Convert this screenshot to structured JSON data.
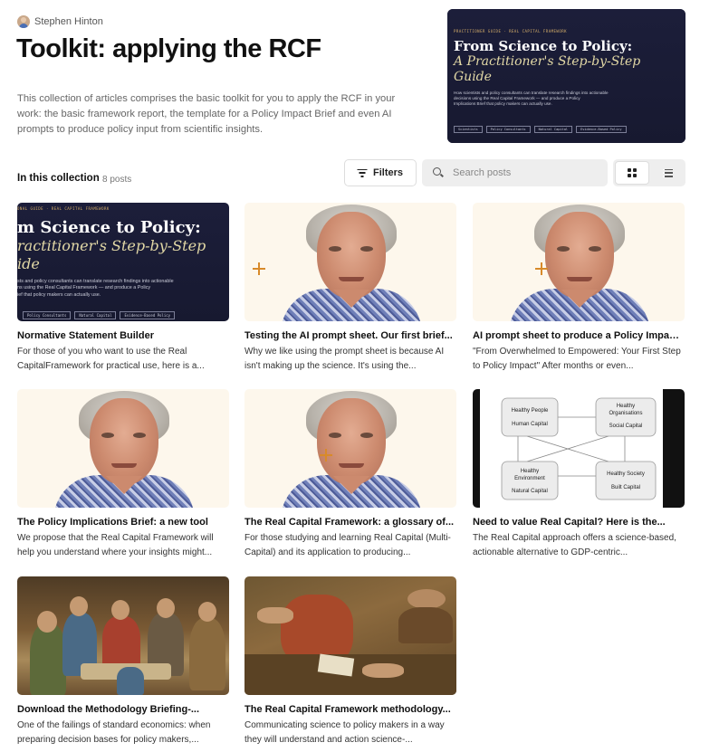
{
  "author": {
    "name": "Stephen Hinton"
  },
  "page": {
    "title": "Toolkit: applying the RCF",
    "description": "This collection of articles comprises the basic toolkit for you to apply the RCF in your work: the basic framework report, the template for a Policy Impact Brief and even AI prompts to produce policy input from scientific insights."
  },
  "hero_cover": {
    "eyebrow": "PRACTITIONER GUIDE · REAL CAPITAL FRAMEWORK",
    "headline": "From Science to Policy:",
    "subheadline_1": "A Practitioner's Step-by-Step",
    "subheadline_2": "Guide",
    "body_1": "How scientists and policy consultants can translate research findings into actionable",
    "body_2": "decisions using the Real Capital Framework — and produce a Policy",
    "body_3": "Implications Brief that policy makers can actually use.",
    "tags": [
      "Scientists",
      "Policy Consultants",
      "Natural Capital",
      "Evidence-Based Policy"
    ]
  },
  "collection": {
    "label": "In this collection",
    "count": "8 posts"
  },
  "toolbar": {
    "filters_label": "Filters",
    "search_placeholder": "Search posts"
  },
  "posts": [
    {
      "title": "Normative Statement Builder",
      "excerpt": "For those of you who want to use the Real CapitalFramework for practical use, here is a...",
      "thumb": "cover",
      "cover": {
        "eyebrow": "ONAL GUIDE · REAL CAPITAL FRAMEWORK",
        "headline": "m Science to Policy:",
        "sub_1": "ractitioner's Step-by-Step",
        "sub_2": "ide",
        "body_1": "sts and policy consultants can translate research findings into actionable",
        "body_2": "ns using the Real Capital Framework — and produce a Policy",
        "body_3": "ief that policy makers can actually use.",
        "tags": [
          "Policy Consultants",
          "Natural Capital",
          "Evidence-Based Policy"
        ]
      }
    },
    {
      "title": "Testing the AI prompt sheet. Our first brief...",
      "excerpt": "Why we like using the prompt sheet is because AI isn't making up the science. It's using the...",
      "thumb": "portrait"
    },
    {
      "title": "AI prompt sheet to produce a Policy Impact...",
      "excerpt": "\"From Overwhelmed to Empowered: Your First Step to Policy Impact\" After months or even...",
      "thumb": "portrait"
    },
    {
      "title": "The Policy Implications Brief: a new tool",
      "excerpt": "We propose that the Real Capital Framework will help you understand where your insights might...",
      "thumb": "portrait"
    },
    {
      "title": "The Real Capital Framework: a glossary of...",
      "excerpt": "For those studying and learning Real Capital (Multi-Capital) and its application to producing...",
      "thumb": "portrait"
    },
    {
      "title": "Need to value Real Capital? Here is the...",
      "excerpt": "The Real Capital approach offers a science-based, actionable alternative to GDP-centric...",
      "thumb": "diagram",
      "diagram": {
        "nodes": [
          {
            "line1": "Healthy People",
            "line2": "Human Capital"
          },
          {
            "line1": "Healthy",
            "line1b": "Organisations",
            "line2": "Social Capital"
          },
          {
            "line1": "Healthy",
            "line1b": "Environment",
            "line2": "Natural Capital"
          },
          {
            "line1": "Healthy Society",
            "line2": "Built Capital"
          }
        ]
      }
    },
    {
      "title": "Download the Methodology Briefing-...",
      "excerpt": "One of the failings of standard economics: when preparing decision bases for policy makers,...",
      "thumb": "painting1"
    },
    {
      "title": "The Real Capital Framework methodology...",
      "excerpt": "Communicating science to policy makers in a way they will understand and action science-...",
      "thumb": "painting2"
    }
  ]
}
